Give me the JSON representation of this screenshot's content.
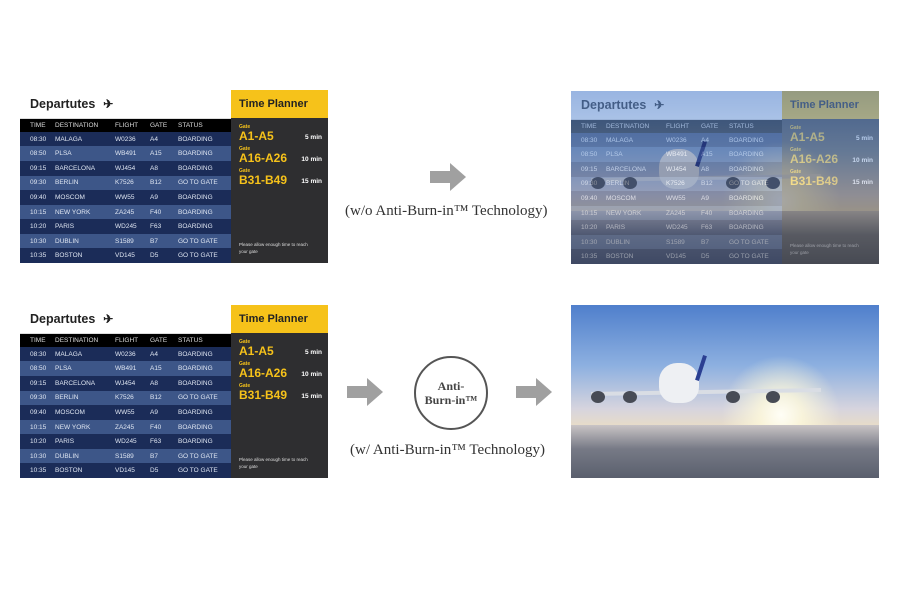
{
  "board": {
    "title": "Departutes",
    "title_icon": "airplane-takeoff-icon",
    "columns": [
      "TIME",
      "DESTINATION",
      "FLIGHT",
      "GATE",
      "STATUS"
    ],
    "rows": [
      [
        "08:30",
        "MALAGA",
        "W0236",
        "A4",
        "BOARDING"
      ],
      [
        "08:50",
        "PLSA",
        "WB491",
        "A15",
        "BOARDING"
      ],
      [
        "09:15",
        "BARCELONA",
        "WJ454",
        "A8",
        "BOARDING"
      ],
      [
        "09:30",
        "BERLIN",
        "K7526",
        "B12",
        "GO TO GATE"
      ],
      [
        "09:40",
        "MOSCOM",
        "WW55",
        "A9",
        "BOARDING"
      ],
      [
        "10:15",
        "NEW YORK",
        "ZA245",
        "F40",
        "BOARDING"
      ],
      [
        "10:20",
        "PARIS",
        "WD245",
        "F63",
        "BOARDING"
      ],
      [
        "10:30",
        "DUBLIN",
        "S1589",
        "B7",
        "GO TO GATE"
      ],
      [
        "10:35",
        "BOSTON",
        "VD145",
        "D5",
        "GO TO GATE"
      ]
    ],
    "planner": {
      "title": "Time Planner",
      "gates": [
        {
          "label": "Gate",
          "code": "A1-A5",
          "time": "5 min"
        },
        {
          "label": "Gate",
          "code": "A16-A26",
          "time": "10 min"
        },
        {
          "label": "Gate",
          "code": "B31-B49",
          "time": "15 min"
        }
      ],
      "note": "Please allow enough time to reach your gate"
    }
  },
  "captions": {
    "without": "(w/o Anti-Burn-in™ Technology)",
    "with": "(w/ Anti-Burn-in™ Technology)"
  },
  "badge": {
    "line1": "Anti-",
    "line2": "Burn-in™"
  },
  "colors": {
    "accent": "#f6c21a",
    "row_dark": "#1b2c58",
    "row_light": "#3d5688",
    "arrow": "#a0a0a0"
  }
}
